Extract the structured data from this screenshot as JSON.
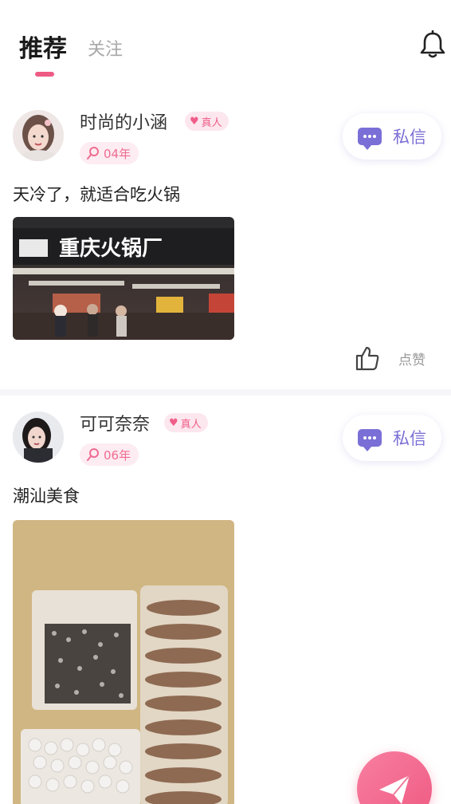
{
  "header": {
    "tab_active": "推荐",
    "tab_inactive": "关注"
  },
  "posts": [
    {
      "username": "时尚的小涵",
      "badge": "真人",
      "age": "04年",
      "message_label": "私信",
      "text": "天冷了，就适合吃火锅",
      "image_sign": "重庆火锅厂",
      "like_label": "点赞"
    },
    {
      "username": "可可奈奈",
      "badge": "真人",
      "age": "06年",
      "message_label": "私信",
      "text": "潮汕美食"
    }
  ],
  "colors": {
    "accent_pink": "#ee5b85",
    "message_purple": "#7a6fd6"
  },
  "icons": [
    "bell-icon",
    "heart-icon",
    "search-icon",
    "chat-icon",
    "thumbs-up-icon",
    "send-icon"
  ]
}
